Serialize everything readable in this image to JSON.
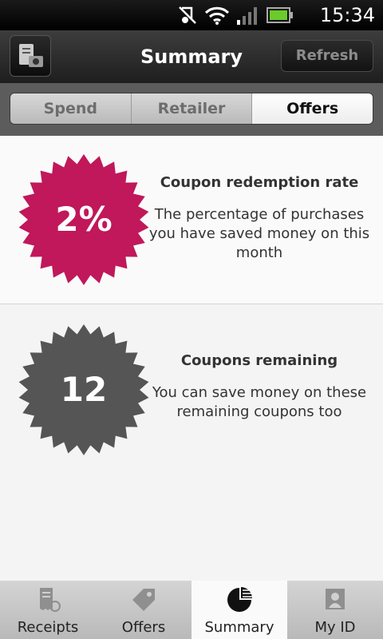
{
  "status_bar": {
    "time": "15:34"
  },
  "header": {
    "title": "Summary",
    "refresh_label": "Refresh"
  },
  "tabs": [
    {
      "label": "Spend",
      "active": false
    },
    {
      "label": "Retailer",
      "active": false
    },
    {
      "label": "Offers",
      "active": true
    }
  ],
  "cards": [
    {
      "value": "2%",
      "heading": "Coupon redemption rate",
      "description": "The percentage of purchases you have saved money on this month",
      "color": "#c0185a"
    },
    {
      "value": "12",
      "heading": "Coupons remaining",
      "description": "You can save money on these remaining coupons too",
      "color": "#555555"
    }
  ],
  "bottom_nav": [
    {
      "label": "Receipts",
      "icon": "receipt-icon",
      "active": false
    },
    {
      "label": "Offers",
      "icon": "coupon-icon",
      "active": false
    },
    {
      "label": "Summary",
      "icon": "pie-chart-icon",
      "active": true
    },
    {
      "label": "My ID",
      "icon": "id-card-icon",
      "active": false
    }
  ]
}
